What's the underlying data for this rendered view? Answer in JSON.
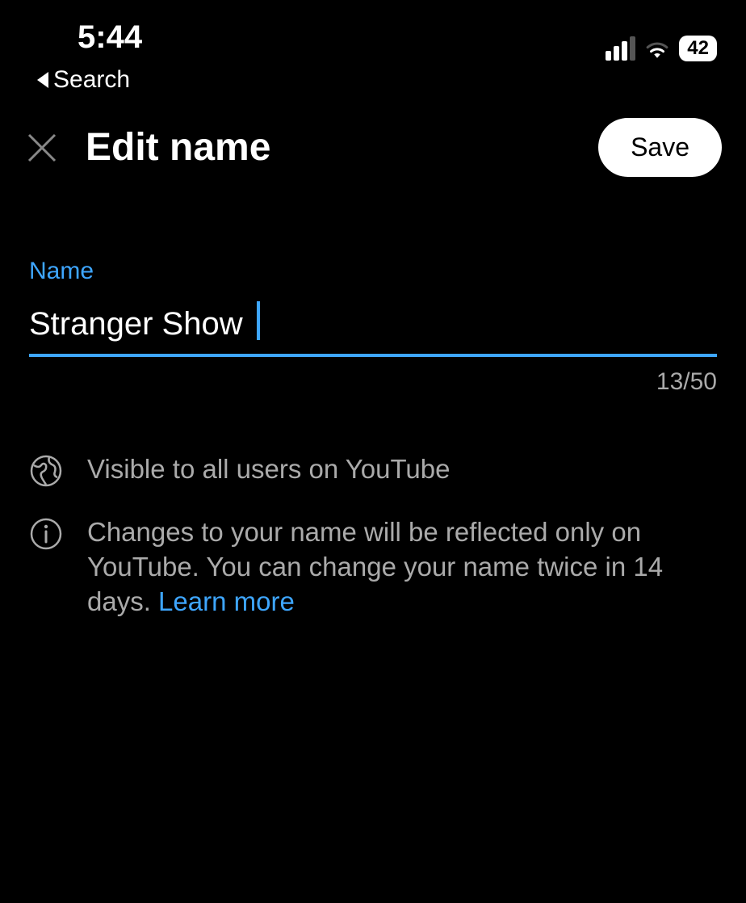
{
  "status_bar": {
    "time": "5:44",
    "battery": "42"
  },
  "back_nav": {
    "label": "Search"
  },
  "header": {
    "title": "Edit name",
    "save_label": "Save"
  },
  "form": {
    "field_label": "Name",
    "value": "Stranger Show",
    "counter": "13/50"
  },
  "notes": {
    "visibility": "Visible to all users on YouTube",
    "change_info": "Changes to your name will be reflected only on YouTube. You can change your name twice in 14 days.",
    "learn_more": "Learn more"
  }
}
